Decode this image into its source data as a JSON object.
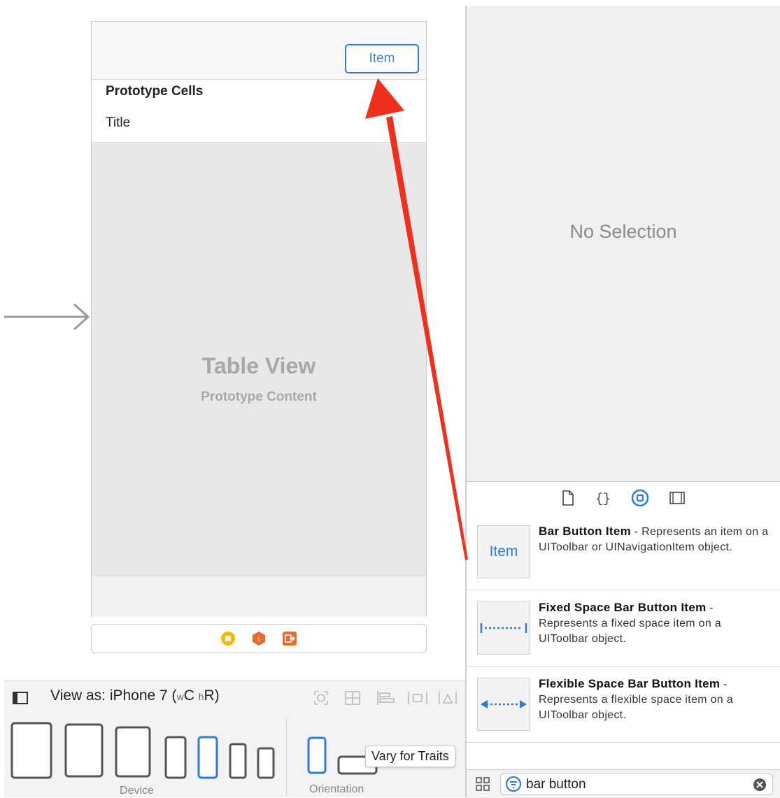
{
  "canvas": {
    "nav_item_label": "Item",
    "prototype_cells_header": "Prototype Cells",
    "cell_title": "Title",
    "table_view_title": "Table View",
    "table_view_subtitle": "Prototype Content"
  },
  "device_bar": {
    "view_as_prefix": "View as: iPhone 7 (",
    "size_w": "w",
    "size_c": "C",
    "size_h": "h",
    "size_r": "R",
    "view_as_suffix": ")",
    "device_caption": "Device",
    "orientation_caption": "Orientation",
    "vary_for_traits": "Vary for Traits"
  },
  "inspector": {
    "empty_label": "No Selection"
  },
  "library": {
    "items": [
      {
        "thumb_label": "Item",
        "name": "Bar Button Item",
        "description": "- Represents an item on a UIToolbar or UINavigationItem object."
      },
      {
        "name": "Fixed Space Bar Button Item",
        "description": "- Represents a fixed space item on a UIToolbar object."
      },
      {
        "name": "Flexible Space Bar Button Item",
        "description": "- Represents a flexible space item on a UIToolbar object."
      }
    ],
    "search_value": "bar button"
  },
  "colors": {
    "accent_blue": "#2f7bd6",
    "annotation_red": "#f0301c"
  },
  "icons": [
    "entry-arrow-icon",
    "view-controller-icon",
    "first-responder-icon",
    "exit-icon",
    "sidebar-toggle-icon",
    "file-icon",
    "braces-icon",
    "object-library-icon",
    "media-library-icon",
    "grid-view-icon",
    "filter-icon",
    "clear-icon"
  ]
}
